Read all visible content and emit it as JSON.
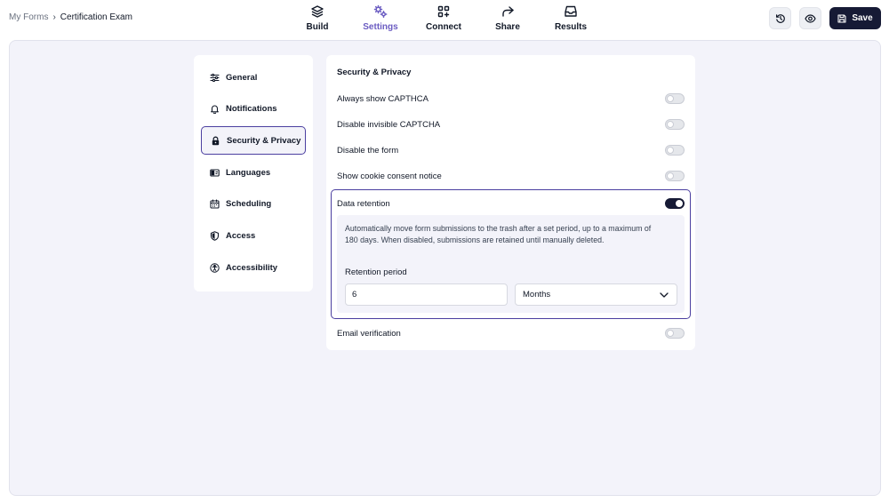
{
  "breadcrumb": {
    "root": "My Forms",
    "separator": "›",
    "current": "Certification Exam"
  },
  "nav": [
    {
      "label": "Build",
      "icon": "layers-icon"
    },
    {
      "label": "Settings",
      "icon": "gears-icon",
      "active": true
    },
    {
      "label": "Connect",
      "icon": "integrations-icon"
    },
    {
      "label": "Share",
      "icon": "share-arrow-icon"
    },
    {
      "label": "Results",
      "icon": "inbox-icon"
    }
  ],
  "actions": {
    "save_label": "Save"
  },
  "colors": {
    "accent": "#4b3fa0",
    "active_nav": "#6b5cc2",
    "primary_button": "#161a35",
    "canvas": "#f3f3fa"
  },
  "sidebar": {
    "items": [
      {
        "label": "General",
        "icon": "sliders-icon"
      },
      {
        "label": "Notifications",
        "icon": "bell-icon"
      },
      {
        "label": "Security & Privacy",
        "icon": "lock-icon",
        "active": true
      },
      {
        "label": "Languages",
        "icon": "language-icon"
      },
      {
        "label": "Scheduling",
        "icon": "calendar-icon"
      },
      {
        "label": "Access",
        "icon": "shield-icon"
      },
      {
        "label": "Accessibility",
        "icon": "accessibility-icon"
      }
    ]
  },
  "panel": {
    "title": "Security & Privacy",
    "settings": [
      {
        "label": "Always show CAPTHCA",
        "enabled": false
      },
      {
        "label": "Disable invisible CAPTCHA",
        "enabled": false
      },
      {
        "label": "Disable the form",
        "enabled": false
      },
      {
        "label": "Show cookie consent notice",
        "enabled": false
      }
    ],
    "retention": {
      "label": "Data retention",
      "enabled": true,
      "description": "Automatically move form submissions to the trash after a set period, up to a maximum of 180 days. When disabled, submissions are retained until manually deleted.",
      "period_label": "Retention period",
      "period_value": "6",
      "unit_selected": "Months"
    },
    "email_verification": {
      "label": "Email verification",
      "enabled": false
    }
  }
}
